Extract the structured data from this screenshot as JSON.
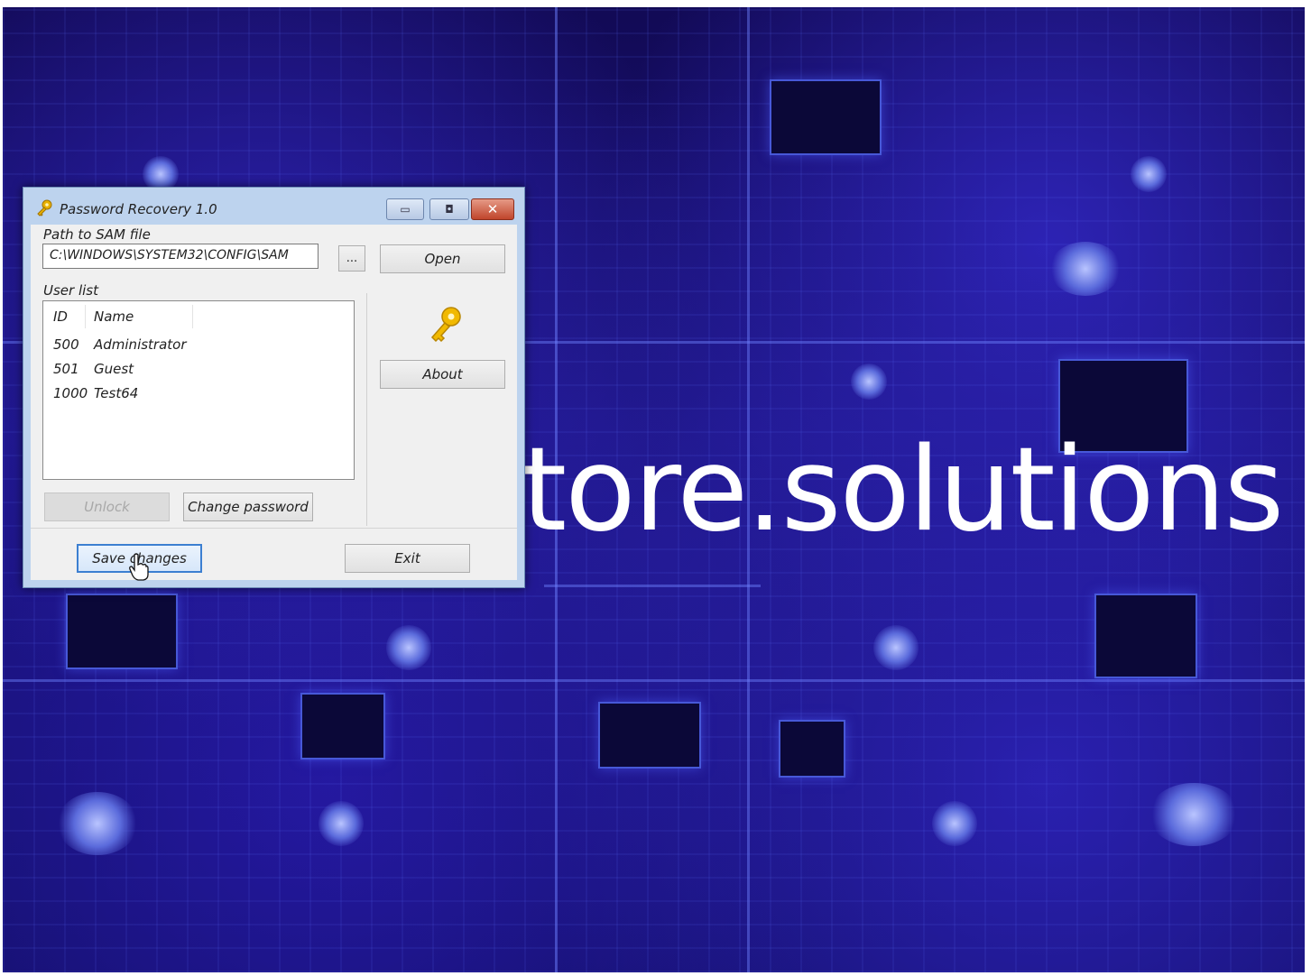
{
  "desktop": {
    "background_text": "tore.solutions",
    "colors": {
      "circuit_dark": "#120a55",
      "circuit_light": "#4758d8"
    }
  },
  "window": {
    "title": "Password Recovery 1.0",
    "icon": "key-icon",
    "caption_buttons": {
      "minimize": "minimize-icon",
      "maximize": "maximize-icon",
      "close": "close-icon"
    }
  },
  "path_section": {
    "label": "Path to SAM file",
    "value": "C:\\WINDOWS\\SYSTEM32\\CONFIG\\SAM",
    "browse_label": "...",
    "open_label": "Open"
  },
  "user_list": {
    "label": "User list",
    "columns": [
      "ID",
      "Name"
    ],
    "rows": [
      {
        "id": "500",
        "name": "Administrator"
      },
      {
        "id": "501",
        "name": "Guest"
      },
      {
        "id": "1000",
        "name": "Test64"
      }
    ]
  },
  "side_panel": {
    "icon": "key-icon",
    "about_label": "About"
  },
  "actions": {
    "unlock_label": "Unlock",
    "change_password_label": "Change password",
    "save_label": "Save changes",
    "exit_label": "Exit"
  },
  "accent_colors": {
    "title_bar": "#bdd3ee",
    "close_button": "#c0452c",
    "focus_border": "#3c7fd1",
    "key_gold": "#e8b000"
  }
}
